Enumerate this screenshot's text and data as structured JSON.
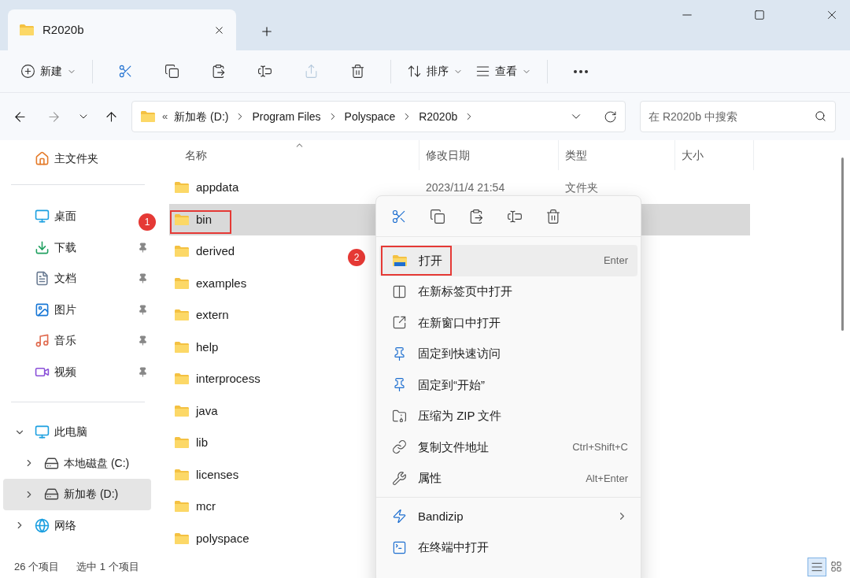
{
  "window": {
    "tab_title": "R2020b"
  },
  "toolbar": [
    {
      "label": "新建",
      "disabled": false
    },
    {
      "disabled": false
    },
    {
      "disabled": false
    },
    {
      "disabled": false
    },
    {
      "disabled": false
    },
    {
      "disabled": true
    },
    {
      "disabled": false
    },
    {
      "label": "排序",
      "disabled": false
    },
    {
      "label": "查看",
      "disabled": false
    },
    {
      "disabled": false
    }
  ],
  "address": {
    "overflow_glyph": "«",
    "crumbs": [
      "新加卷 (D:)",
      "Program Files",
      "Polyspace",
      "R2020b"
    ],
    "search_placeholder": "在 R2020b 中搜索"
  },
  "sidebar": {
    "home": {
      "label": "主文件夹"
    },
    "quick_access": [
      {
        "label": "桌面",
        "pinned": false
      },
      {
        "label": "下载",
        "pinned": true
      },
      {
        "label": "文档",
        "pinned": true
      },
      {
        "label": "图片",
        "pinned": true
      },
      {
        "label": "音乐",
        "pinned": true
      },
      {
        "label": "视频",
        "pinned": true
      }
    ],
    "tree": [
      {
        "label": "此电脑",
        "expanded": true,
        "selected": false,
        "children": [
          {
            "label": "本地磁盘 (C:)",
            "expanded": false,
            "selected": false
          },
          {
            "label": "新加卷 (D:)",
            "expanded": false,
            "selected": true
          }
        ]
      },
      {
        "label": "网络",
        "expanded": false,
        "selected": false
      }
    ]
  },
  "table": {
    "columns": [
      "名称",
      "修改日期",
      "类型",
      "大小"
    ],
    "rows": [
      {
        "name": "appdata",
        "date": "2023/11/4 21:54",
        "type": "文件夹",
        "selected": false
      },
      {
        "name": "bin",
        "selected": true
      },
      {
        "name": "derived",
        "selected": false
      },
      {
        "name": "examples",
        "selected": false
      },
      {
        "name": "extern",
        "selected": false
      },
      {
        "name": "help",
        "selected": false
      },
      {
        "name": "interprocess",
        "selected": false
      },
      {
        "name": "java",
        "selected": false
      },
      {
        "name": "lib",
        "selected": false
      },
      {
        "name": "licenses",
        "selected": false
      },
      {
        "name": "mcr",
        "selected": false
      },
      {
        "name": "polyspace",
        "selected": false
      }
    ]
  },
  "status_bar": {
    "count": "26 个项目",
    "selection": "选中 1 个项目",
    "views": [
      {
        "selected": true
      },
      {
        "selected": false
      }
    ]
  },
  "context_menu": {
    "groups": [
      [
        {
          "label": "打开",
          "shortcut": "Enter",
          "highlighted": true
        },
        {
          "label": "在新标签页中打开",
          "highlighted": false
        },
        {
          "label": "在新窗口中打开",
          "highlighted": false
        },
        {
          "label": "固定到快速访问",
          "highlighted": false
        },
        {
          "label": "固定到“开始”",
          "highlighted": false
        },
        {
          "label": "压缩为 ZIP 文件",
          "highlighted": false
        },
        {
          "label": "复制文件地址",
          "shortcut": "Ctrl+Shift+C",
          "highlighted": false
        },
        {
          "label": "属性",
          "shortcut": "Alt+Enter",
          "highlighted": false
        }
      ],
      [
        {
          "label": "Bandizip",
          "submenu": true,
          "highlighted": false
        },
        {
          "label": "在终端中打开",
          "highlighted": false
        }
      ]
    ]
  },
  "annotations": [
    {
      "number": "1"
    },
    {
      "number": "2"
    }
  ]
}
